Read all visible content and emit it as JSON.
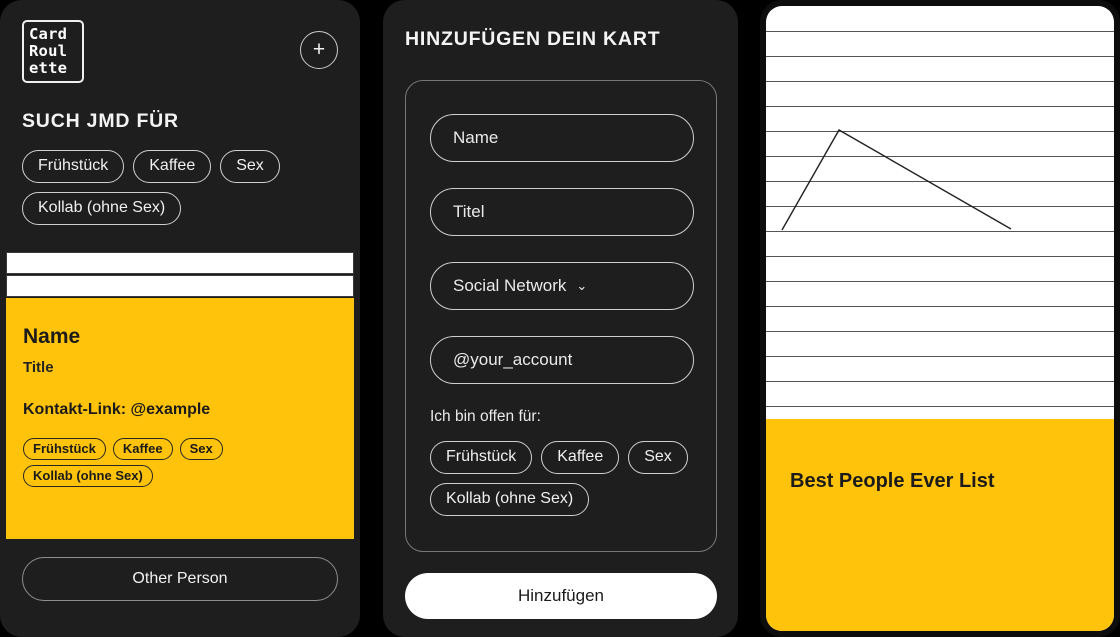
{
  "app": {
    "background_color": "#000000",
    "panel_color": "#1e1e1e",
    "accent_yellow": "#FFC30B",
    "paper_white": "#FFFFFF"
  },
  "discover_panel": {
    "logo": {
      "name": "card-roulette-logo",
      "line1": "Card",
      "line2": "Roul",
      "line3": "ette"
    },
    "add_button_label": "+",
    "section_title": "SUCH JMD FÜR",
    "filter_chips": [
      "Frühstück",
      "Kaffee",
      "Sex",
      "Kollab (ohne Sex)"
    ],
    "card": {
      "name": "Name",
      "title": "Title",
      "contact": "Kontakt-Link: @example",
      "chips": [
        "Frühstück",
        "Kaffee",
        "Sex",
        "Kollab (ohne Sex)"
      ]
    },
    "other_person_label": "Other Person"
  },
  "add_panel": {
    "title": "HINZUFÜGEN DEIN KART",
    "fields": {
      "name_placeholder": "Name",
      "title_placeholder": "Titel",
      "social_network_value": "Social Network",
      "social_network_chevron": "⌄",
      "account_placeholder": "@your_account"
    },
    "open_for_label": "Ich bin offen für:",
    "open_for_chips": [
      "Frühstück",
      "Kaffee",
      "Sex",
      "Kollab (ohne Sex)"
    ],
    "submit_label": "Hinzufügen"
  },
  "list_panel": {
    "title": "Best People Ever List",
    "rule_count": 21,
    "rule_spacing": 25,
    "chart_data": {
      "type": "line",
      "title": "",
      "xlabel": "",
      "ylabel": "",
      "grid": true,
      "points": [
        {
          "x": 16,
          "y": 224
        },
        {
          "x": 73,
          "y": 124
        },
        {
          "x": 245,
          "y": 223
        }
      ],
      "xlim": [
        0,
        348
      ],
      "ylim": [
        0,
        430
      ]
    }
  }
}
